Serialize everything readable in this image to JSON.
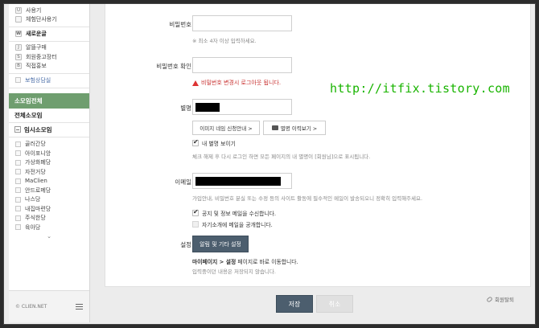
{
  "sidebar": {
    "group1": [
      {
        "key": "U",
        "label": "사용기"
      },
      {
        "key": "",
        "label": "체험단사용기"
      }
    ],
    "group2": [
      {
        "key": "W",
        "label": "새로운글",
        "bold": true
      }
    ],
    "group3": [
      {
        "key": "J",
        "label": "알뜰구매"
      },
      {
        "key": "S",
        "label": "회원중고장터"
      },
      {
        "key": "B",
        "label": "직접홍보"
      }
    ],
    "group4": [
      {
        "key": "",
        "label": "보험상담실",
        "blue": true
      }
    ],
    "active_label": "소모임전체",
    "all_groups_label": "전체소모임",
    "temp_groups_label": "임시소모임",
    "groups": [
      "골러간당",
      "아이포니앙",
      "가상화폐당",
      "자전거당",
      "MaClien",
      "안드로메당",
      "나스당",
      "내집마련당",
      "주식한당",
      "육아당"
    ],
    "scroll_glyph": "⌄",
    "footer_copy": "© CLIEN.NET",
    "menu_icon": "hamburger-icon"
  },
  "form": {
    "password_label": "비밀번호",
    "password_hint": "※ 최소 4자 이상 입력하세요.",
    "password_confirm_label": "비밀번호 확인",
    "password_warning": "비밀번호 변경시 로그아웃 됩니다.",
    "nickname_label": "별명",
    "icon_request_button": "이미지 네임 신청안내 >",
    "nickname_history_button": "별명 이력보기 >",
    "show_nickname_label": "내 별명 보이기",
    "show_nickname_checked": true,
    "show_nickname_hint": "체크 해제 후 다시 로그인 하면 모든 페이지의 내 별명이 [회원님]으로 표시됩니다.",
    "email_label": "이메일",
    "email_hint": "가입안내, 비밀번호 분실 또는 수정 등의 사이트 활동에 필수적인 메일이 발송되오니 정확히 입력해주세요.",
    "receive_mail_label": "공지 및 정보 메일을 수신합니다.",
    "receive_mail_checked": true,
    "public_email_label": "자기소개에 메일을 공개합니다.",
    "public_email_checked": false,
    "settings_label": "설정",
    "settings_button": "알림 및 기타 설정",
    "settings_desc_prefix": "마이페이지 > 설정",
    "settings_desc_suffix": " 페이지로 바로 이동합니다.",
    "settings_desc_line2": "입력중이던 내용은 저장되지 않습니다."
  },
  "watermark": "http://itfix.tistory.com",
  "actions": {
    "save": "저장",
    "cancel": "취소",
    "withdraw": "회원탈퇴"
  },
  "colors": {
    "active_green": "#6f9e6f",
    "dark_button": "#4c5e6e",
    "warning_red": "#c8302f",
    "watermark_green": "#19b400"
  }
}
